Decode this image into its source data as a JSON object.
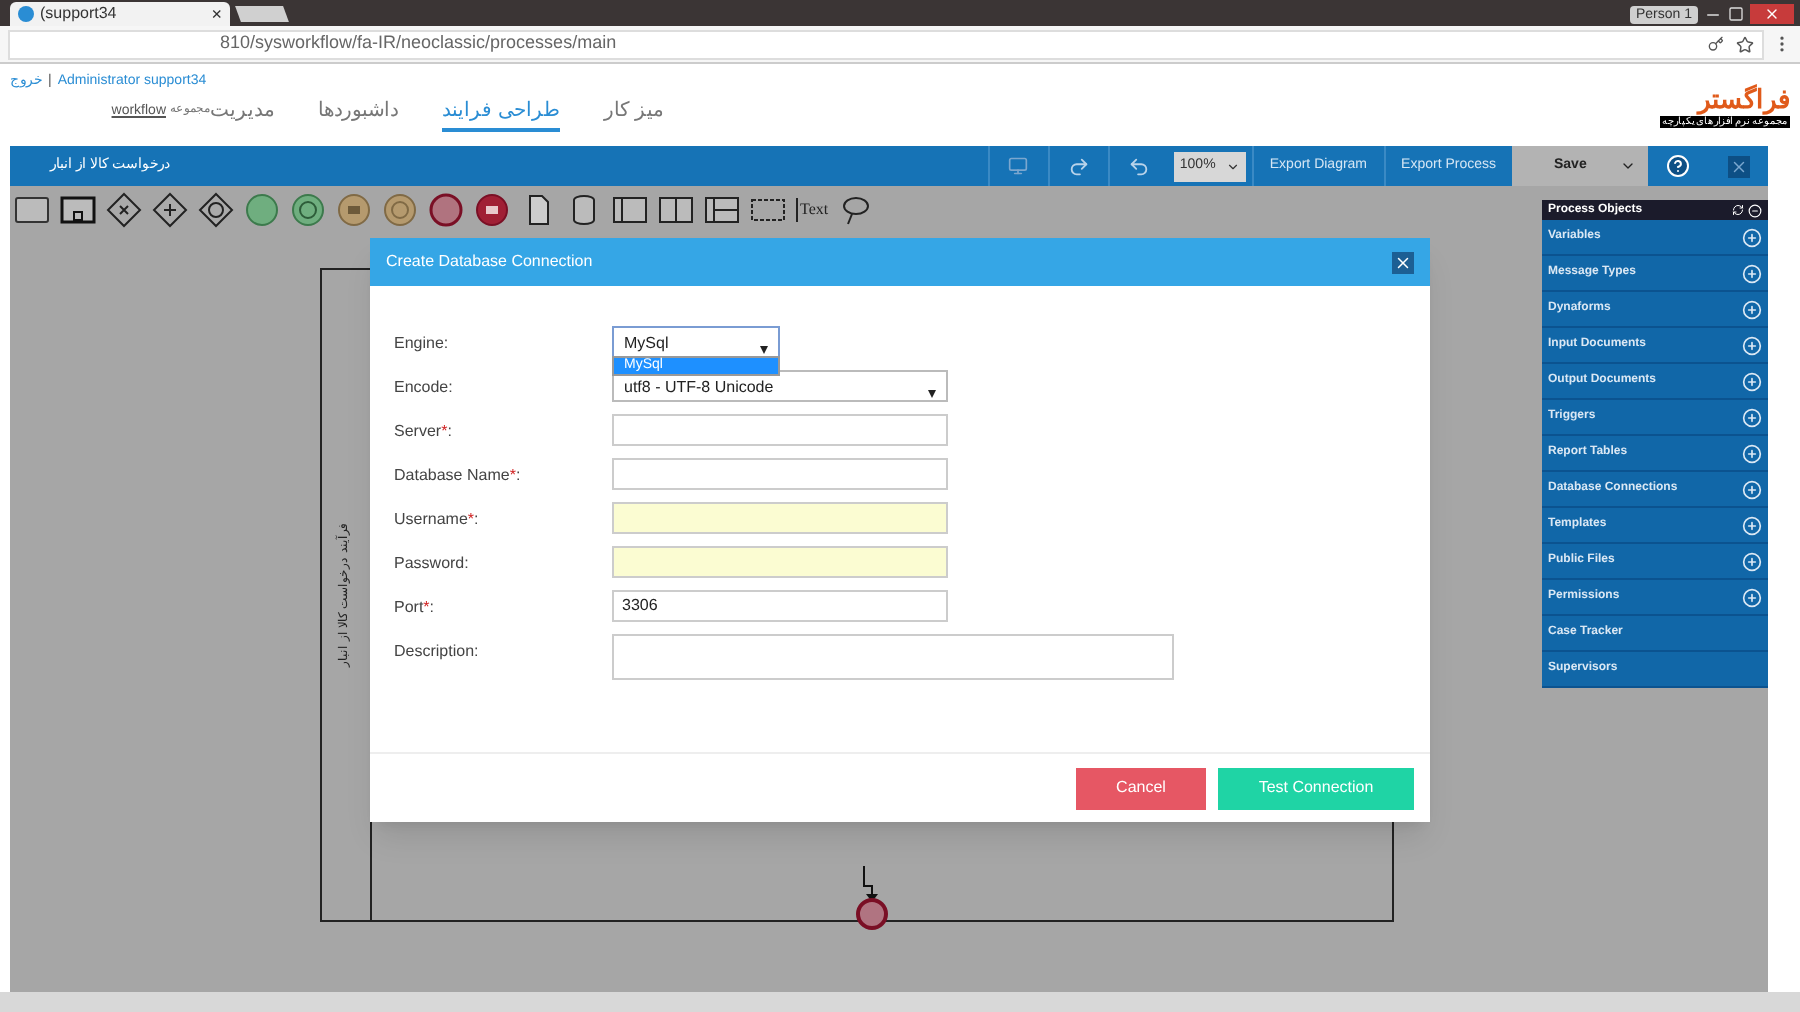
{
  "browser": {
    "tab_title": "(support34",
    "tab_close": "×",
    "url": "810/sysworkflow/fa-IR/neoclassic/processes/main",
    "profile": "Person 1"
  },
  "header": {
    "logout": "خروج",
    "separator": "|",
    "user": "Administrator support34",
    "workspace_label": "مجموعه",
    "workspace": "workflow",
    "nav": [
      {
        "label": "میز کار",
        "selected": false
      },
      {
        "label": "طراحی فرایند",
        "selected": true
      },
      {
        "label": "داشبوردها",
        "selected": false
      },
      {
        "label": "مدیریت",
        "selected": false
      }
    ],
    "logo": "فراگستر",
    "logo_subtitle": "مجموعه نرم افزارهای یکپارچه"
  },
  "designer_bar": {
    "process_title": "درخواست کالا از انبار",
    "zoom": "100%",
    "export_diagram": "Export Diagram",
    "export_process": "Export Process",
    "save": "Save"
  },
  "shapes_toolbar": {
    "text_tool": "Text"
  },
  "canvas": {
    "pool_label": "فرآیند درخواست کالا از انبار"
  },
  "dialog": {
    "title": "Create Database Connection",
    "fields": [
      {
        "kind": "select",
        "label": "Engine",
        "colon": ":",
        "value": "MySql",
        "open": true,
        "options": [
          {
            "label": "MySql",
            "selected": true
          }
        ]
      },
      {
        "kind": "select",
        "label": "Encode",
        "colon": ":",
        "value": "utf8 - UTF-8 Unicode",
        "open": false
      },
      {
        "kind": "text",
        "label": "Server",
        "required_mark": "*",
        "colon": ":",
        "highlighted": false
      },
      {
        "kind": "text",
        "label": "Database Name",
        "required_mark": "*",
        "colon": ":",
        "highlighted": false
      },
      {
        "kind": "text",
        "label": "Username",
        "required_mark": "*",
        "colon": ":",
        "highlighted": true
      },
      {
        "kind": "text",
        "label": "Password",
        "colon": ":",
        "highlighted": true
      },
      {
        "kind": "text",
        "label": "Port",
        "required_mark": "*",
        "colon": ":",
        "value": "3306",
        "highlighted": false
      },
      {
        "kind": "textarea",
        "label": "Description",
        "colon": ":"
      }
    ],
    "buttons": [
      {
        "kind": "cancel",
        "label": "Cancel"
      },
      {
        "kind": "primary",
        "label": "Test Connection"
      }
    ]
  },
  "process_objects": {
    "title": "Process Objects",
    "items": [
      {
        "label": "Variables",
        "addable": true
      },
      {
        "label": "Message Types",
        "addable": true
      },
      {
        "label": "Dynaforms",
        "addable": true
      },
      {
        "label": "Input Documents",
        "addable": true
      },
      {
        "label": "Output Documents",
        "addable": true
      },
      {
        "label": "Triggers",
        "addable": true
      },
      {
        "label": "Report Tables",
        "addable": true
      },
      {
        "label": "Database Connections",
        "addable": true
      },
      {
        "label": "Templates",
        "addable": true
      },
      {
        "label": "Public Files",
        "addable": true
      },
      {
        "label": "Permissions",
        "addable": true
      },
      {
        "label": "Case Tracker",
        "addable": false
      },
      {
        "label": "Supervisors",
        "addable": false
      }
    ]
  }
}
